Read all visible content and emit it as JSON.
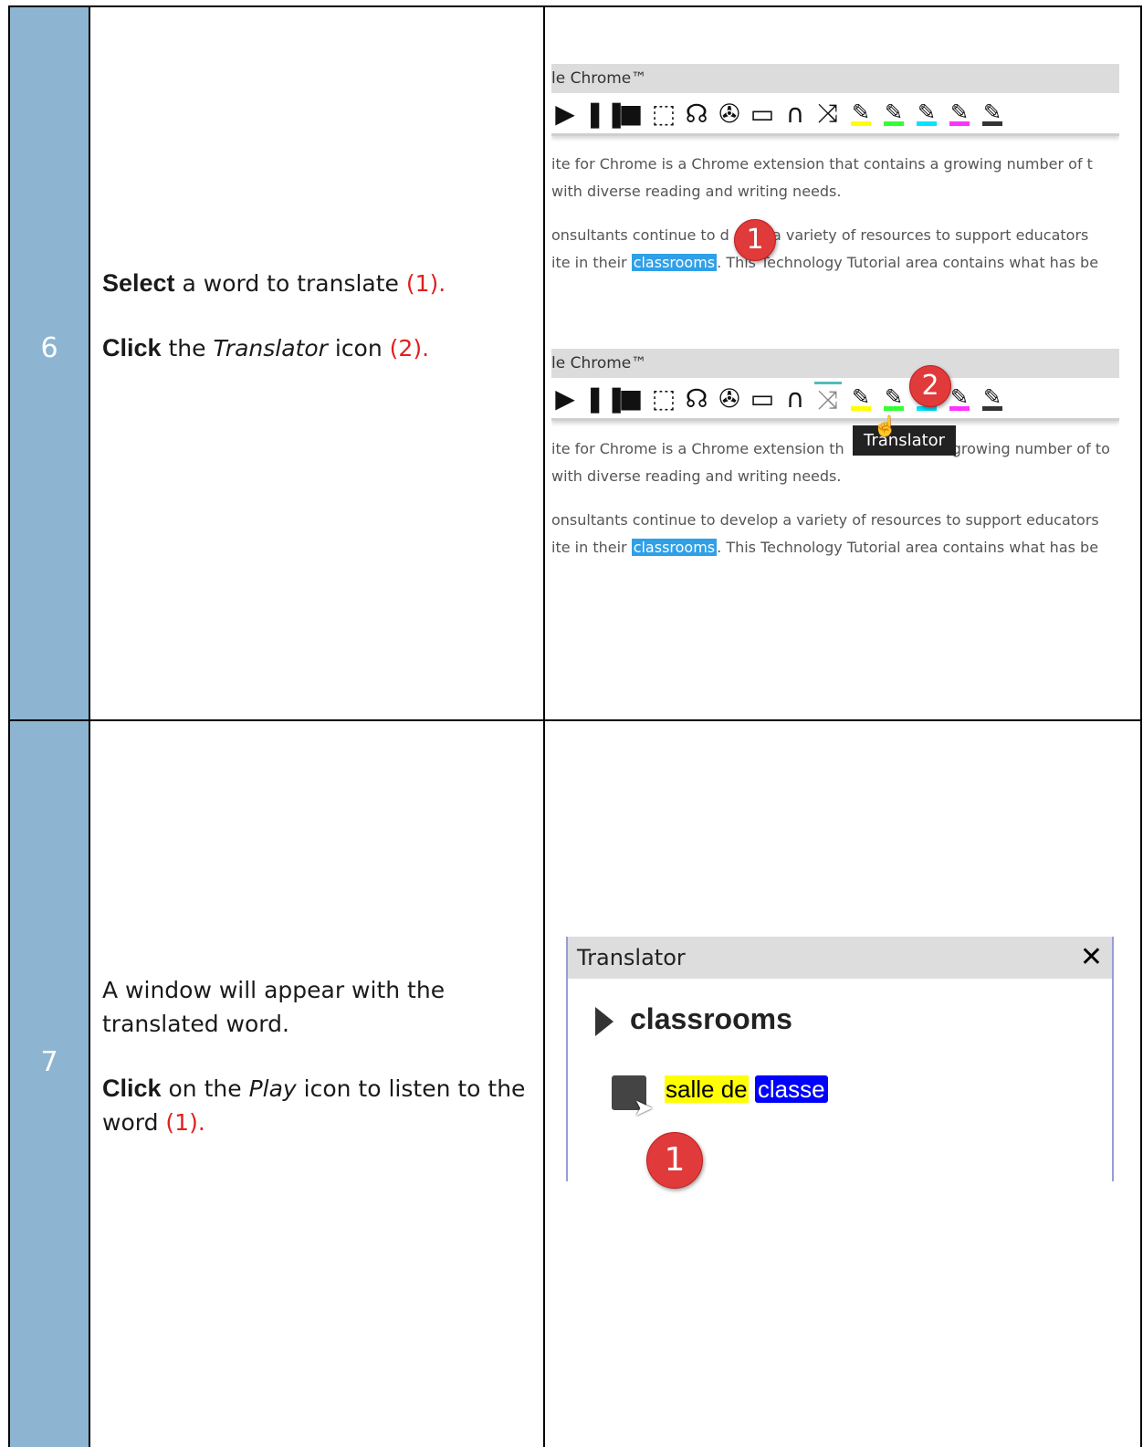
{
  "rows": [
    {
      "number": "6",
      "step1_bold": "Select",
      "step1_text": " a word to translate ",
      "step1_ref": "(1).",
      "step2_bold": "Click",
      "step2_text1": " the ",
      "step2_italic": "Translator",
      "step2_text2": " icon ",
      "step2_ref": "(2)."
    },
    {
      "number": "7",
      "step1_text": "A window will appear with the translated word.",
      "step2_bold": "Click",
      "step2_text1": " on the ",
      "step2_italic": "Play",
      "step2_text2": " icon to listen to the word ",
      "step2_ref": "(1)."
    }
  ],
  "shot1": {
    "titlebar": "le Chrome™",
    "para1_line1": "ite for Chrome is a Chrome extension that contains a growing number of t",
    "para1_line2": "with diverse reading and writing needs.",
    "para2_line1a": "onsultants continue to d",
    "para2_line1b": "p a variety of resources to support educators",
    "para2_line2a": "ite in their ",
    "para2_highlight": "classrooms",
    "para2_line2b": ". This Technology Tutorial area contains what has be",
    "badge": "1"
  },
  "shot2": {
    "titlebar": "le Chrome™",
    "tooltip": "Translator",
    "para1_line1a": "ite for Chrome is a Chrome extension th",
    "para1_line1b": "growing number of to",
    "para1_line2": "with diverse reading and writing needs.",
    "para2_line1": "onsultants continue to develop a variety of resources to support educators",
    "para2_line2a": "ite in their ",
    "para2_highlight": "classrooms",
    "para2_line2b": ". This Technology Tutorial area contains what has be",
    "badge": "2"
  },
  "translator": {
    "title": "Translator",
    "close": "✕",
    "word": "classrooms",
    "translation_a": "salle de",
    "translation_b": "classe",
    "badge": "1"
  },
  "colors": {
    "number_column": "#8db5d1",
    "reference_red": "#e0201c",
    "selection_blue": "#2fa0e8"
  }
}
